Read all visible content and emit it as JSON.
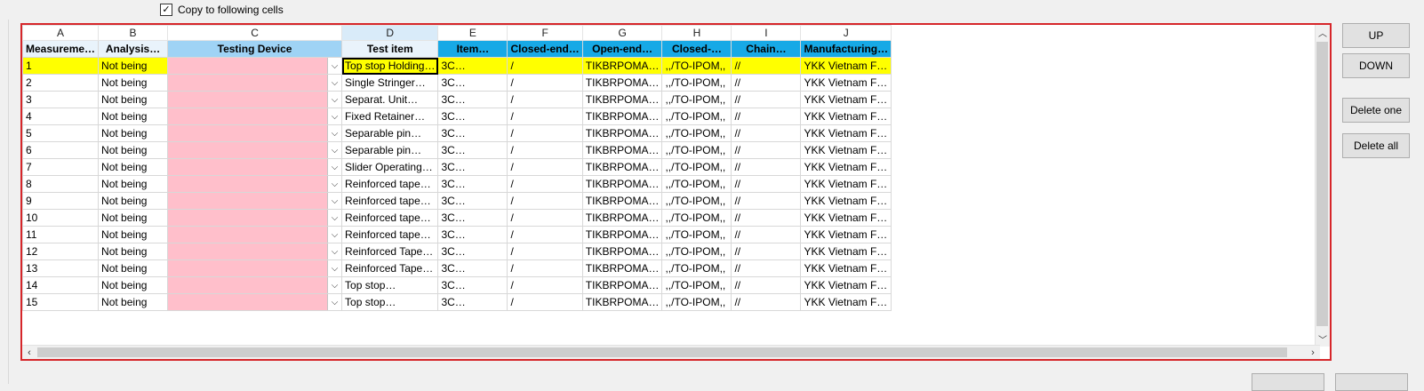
{
  "copy_option": {
    "label": "Copy to following cells",
    "checked": true
  },
  "column_letters": [
    "A",
    "B",
    "C",
    "D",
    "E",
    "F",
    "G",
    "H",
    "I",
    "J"
  ],
  "headers": [
    "Measureme…",
    "Analysis…",
    "Testing Device",
    "Test item",
    "Item…",
    "Closed-end…",
    "Open-end…",
    "Closed-…",
    "Chain…",
    "Manufacturing…"
  ],
  "rows": [
    {
      "a": "1",
      "b": "Not being",
      "d": "Top stop Holding…",
      "e": "3C…",
      "f": "/",
      "g": "TIKBRPOMA…",
      "h": ",,/TO-IPOM,,",
      "i": "//",
      "j": "YKK Vietnam F…"
    },
    {
      "a": "2",
      "b": "Not being",
      "d": "Single Stringer…",
      "e": "3C…",
      "f": "/",
      "g": "TIKBRPOMA…",
      "h": ",,/TO-IPOM,,",
      "i": "//",
      "j": "YKK Vietnam F…"
    },
    {
      "a": "3",
      "b": "Not being",
      "d": "Separat. Unit…",
      "e": "3C…",
      "f": "/",
      "g": "TIKBRPOMA…",
      "h": ",,/TO-IPOM,,",
      "i": "//",
      "j": "YKK Vietnam F…"
    },
    {
      "a": "4",
      "b": "Not being",
      "d": "Fixed Retainer…",
      "e": "3C…",
      "f": "/",
      "g": "TIKBRPOMA…",
      "h": ",,/TO-IPOM,,",
      "i": "//",
      "j": "YKK Vietnam F…"
    },
    {
      "a": "5",
      "b": "Not being",
      "d": "Separable pin…",
      "e": "3C…",
      "f": "/",
      "g": "TIKBRPOMA…",
      "h": ",,/TO-IPOM,,",
      "i": "//",
      "j": "YKK Vietnam F…"
    },
    {
      "a": "6",
      "b": "Not being",
      "d": "Separable pin…",
      "e": "3C…",
      "f": "/",
      "g": "TIKBRPOMA…",
      "h": ",,/TO-IPOM,,",
      "i": "//",
      "j": "YKK Vietnam F…"
    },
    {
      "a": "7",
      "b": "Not being",
      "d": "Slider Operating…",
      "e": "3C…",
      "f": "/",
      "g": "TIKBRPOMA…",
      "h": ",,/TO-IPOM,,",
      "i": "//",
      "j": "YKK Vietnam F…"
    },
    {
      "a": "8",
      "b": "Not being",
      "d": "Reinforced tape…",
      "e": "3C…",
      "f": "/",
      "g": "TIKBRPOMA…",
      "h": ",,/TO-IPOM,,",
      "i": "//",
      "j": "YKK Vietnam F…"
    },
    {
      "a": "9",
      "b": "Not being",
      "d": "Reinforced tape…",
      "e": "3C…",
      "f": "/",
      "g": "TIKBRPOMA…",
      "h": ",,/TO-IPOM,,",
      "i": "//",
      "j": "YKK Vietnam F…"
    },
    {
      "a": "10",
      "b": "Not being",
      "d": "Reinforced tape…",
      "e": "3C…",
      "f": "/",
      "g": "TIKBRPOMA…",
      "h": ",,/TO-IPOM,,",
      "i": "//",
      "j": "YKK Vietnam F…"
    },
    {
      "a": "11",
      "b": "Not being",
      "d": "Reinforced tape…",
      "e": "3C…",
      "f": "/",
      "g": "TIKBRPOMA…",
      "h": ",,/TO-IPOM,,",
      "i": "//",
      "j": "YKK Vietnam F…"
    },
    {
      "a": "12",
      "b": "Not being",
      "d": "Reinforced Tape…",
      "e": "3C…",
      "f": "/",
      "g": "TIKBRPOMA…",
      "h": ",,/TO-IPOM,,",
      "i": "//",
      "j": "YKK Vietnam F…"
    },
    {
      "a": "13",
      "b": "Not being",
      "d": "Reinforced Tape…",
      "e": "3C…",
      "f": "/",
      "g": "TIKBRPOMA…",
      "h": ",,/TO-IPOM,,",
      "i": "//",
      "j": "YKK Vietnam F…"
    },
    {
      "a": "14",
      "b": "Not being",
      "d": "Top stop…",
      "e": "3C…",
      "f": "/",
      "g": "TIKBRPOMA…",
      "h": ",,/TO-IPOM,,",
      "i": "//",
      "j": "YKK Vietnam F…"
    },
    {
      "a": "15",
      "b": "Not being",
      "d": "Top stop…",
      "e": "3C…",
      "f": "/",
      "g": "TIKBRPOMA…",
      "h": ",,/TO-IPOM,,",
      "i": "//",
      "j": "YKK Vietnam F…"
    }
  ],
  "selected_row_index": 0,
  "buttons": {
    "up": "UP",
    "down": "DOWN",
    "delete_one": "Delete one",
    "delete_all": "Delete all"
  },
  "colors": {
    "frame_border": "#d6262a",
    "selected_row": "#ffff00",
    "testing_device_fill": "#ffbfcb",
    "header_blue": "#17a9e6",
    "header_light_blue": "#9fd3f5"
  },
  "icons": {
    "dropdown": "chevron-down-icon",
    "scroll_up": "arrow-up-icon",
    "scroll_down": "arrow-down-icon",
    "scroll_left": "arrow-left-icon",
    "scroll_right": "arrow-right-icon",
    "checkbox": "checkmark-icon"
  }
}
